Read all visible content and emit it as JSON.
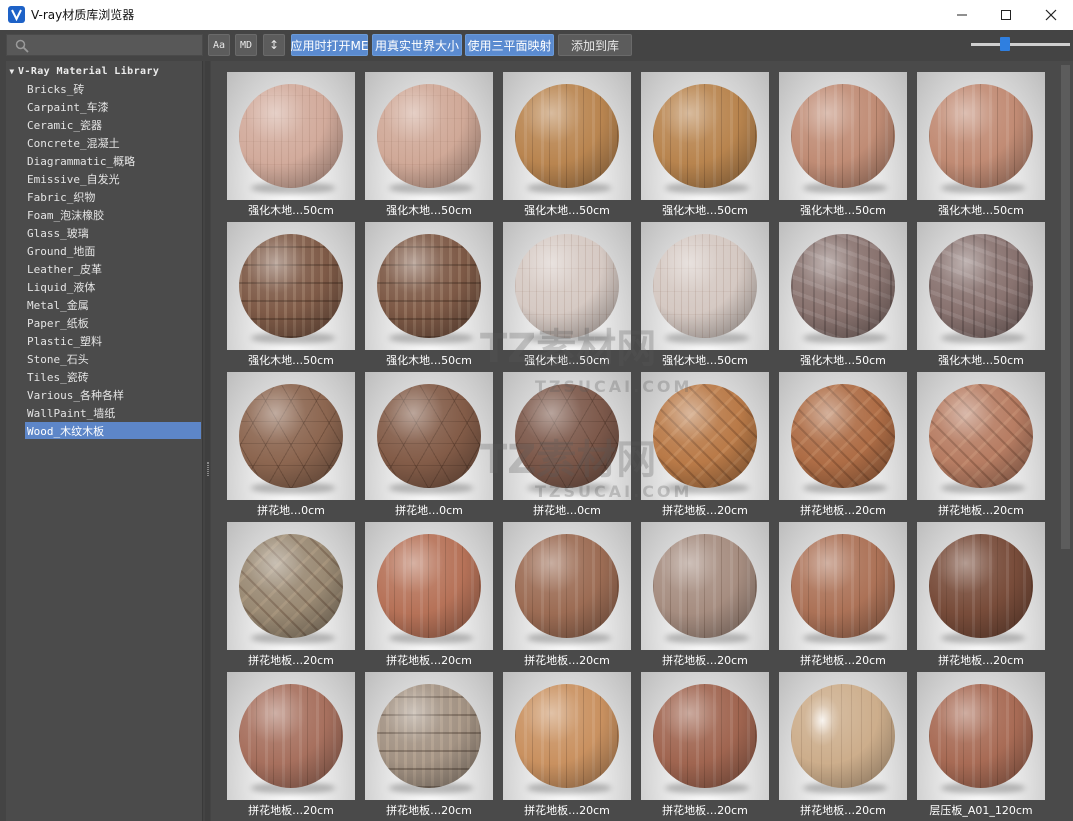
{
  "window": {
    "title": "V-ray材质库浏览器",
    "controls": [
      "minimize-icon",
      "maximize-icon",
      "close-icon"
    ]
  },
  "toolbar": {
    "search_placeholder": "",
    "buttons": [
      {
        "label": "Aa",
        "style": "gray"
      },
      {
        "label": "MD",
        "style": "gray"
      },
      {
        "label": "↕",
        "style": "gray"
      },
      {
        "label": "应用时打开ME",
        "style": "blue"
      },
      {
        "label": "用真实世界大小",
        "style": "blue"
      },
      {
        "label": "使用三平面映射",
        "style": "blue"
      },
      {
        "label": "添加到库",
        "style": "gray"
      }
    ],
    "zoom_slider": 0.35
  },
  "sidebar": {
    "root": "V-Ray Material Library",
    "items": [
      "Bricks_砖",
      "Carpaint_车漆",
      "Ceramic_瓷器",
      "Concrete_混凝土",
      "Diagrammatic_概略",
      "Emissive_自发光",
      "Fabric_织物",
      "Foam_泡沫橡胶",
      "Glass_玻璃",
      "Ground_地面",
      "Leather_皮革",
      "Liquid_液体",
      "Metal_金属",
      "Paper_纸板",
      "Plastic_塑料",
      "Stone_石头",
      "Tiles_瓷砖",
      "Various_各种各样",
      "WallPaint_墙纸",
      "Wood_木纹木板"
    ],
    "selected_index": 19
  },
  "materials": [
    {
      "label": "强化木地…50cm",
      "color": "#d2ab9c",
      "grain": "light"
    },
    {
      "label": "强化木地…50cm",
      "color": "#d0a998",
      "grain": "light"
    },
    {
      "label": "强化木地…50cm",
      "color": "#b98550",
      "grain": "plank"
    },
    {
      "label": "强化木地…50cm",
      "color": "#b8844e",
      "grain": "plank"
    },
    {
      "label": "强化木地…50cm",
      "color": "#c08c75",
      "grain": "plank"
    },
    {
      "label": "强化木地…50cm",
      "color": "#c18b74",
      "grain": "plank"
    },
    {
      "label": "强化木地…50cm",
      "color": "#7e5a47",
      "grain": "block"
    },
    {
      "label": "强化木地…50cm",
      "color": "#7d5946",
      "grain": "block"
    },
    {
      "label": "强化木地…50cm",
      "color": "#d6cac4",
      "grain": "light"
    },
    {
      "label": "强化木地…50cm",
      "color": "#d5c9c3",
      "grain": "light"
    },
    {
      "label": "强化木地…50cm",
      "color": "#8a7470",
      "grain": "rough"
    },
    {
      "label": "强化木地…50cm",
      "color": "#897370",
      "grain": "rough"
    },
    {
      "label": "拼花地…0cm",
      "color": "#8c6650",
      "grain": "hex"
    },
    {
      "label": "拼花地…0cm",
      "color": "#835c48",
      "grain": "hex"
    },
    {
      "label": "拼花地…0cm",
      "color": "#7d594b",
      "grain": "hex"
    },
    {
      "label": "拼花地板…20cm",
      "color": "#b97a48",
      "grain": "herring"
    },
    {
      "label": "拼花地板…20cm",
      "color": "#ae6d46",
      "grain": "herring"
    },
    {
      "label": "拼花地板…20cm",
      "color": "#b77d63",
      "grain": "herring"
    },
    {
      "label": "拼花地板…20cm",
      "color": "#9a8a74",
      "grain": "herring"
    },
    {
      "label": "拼花地板…20cm",
      "color": "#b67258",
      "grain": "plank"
    },
    {
      "label": "拼花地板…20cm",
      "color": "#9c6c54",
      "grain": "plank"
    },
    {
      "label": "拼花地板…20cm",
      "color": "#a68d80",
      "grain": "plank"
    },
    {
      "label": "拼花地板…20cm",
      "color": "#ac7257",
      "grain": "plank"
    },
    {
      "label": "拼花地板…20cm",
      "color": "#784c3a",
      "grain": "plank"
    },
    {
      "label": "拼花地板…20cm",
      "color": "#a7705e",
      "grain": "plank"
    },
    {
      "label": "拼花地板…20cm",
      "color": "#a29283",
      "grain": "block"
    },
    {
      "label": "拼花地板…20cm",
      "color": "#c99160",
      "grain": "plank"
    },
    {
      "label": "拼花地板…20cm",
      "color": "#a06550",
      "grain": "plank"
    },
    {
      "label": "拼花地板…20cm",
      "color": "#cdae8c",
      "grain": "glossy"
    },
    {
      "label": "层压板_A01_120cm",
      "color": "#a86b55",
      "grain": "plank"
    }
  ],
  "watermark": {
    "brand": "TZ素材网",
    "domain": "TZSUCAI.COM"
  }
}
